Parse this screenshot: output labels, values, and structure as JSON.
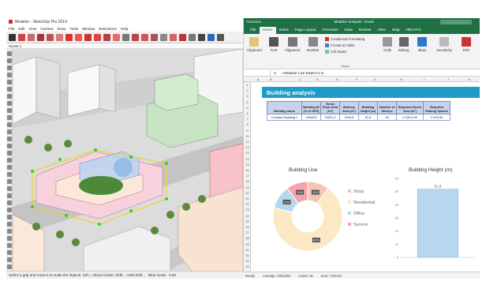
{
  "sketchup": {
    "title": "Modelur - SketchUp Pro 2019",
    "menu": [
      "File",
      "Edit",
      "View",
      "Camera",
      "Draw",
      "Tools",
      "Window",
      "Extensions",
      "Help"
    ],
    "scene_tab": "Scene 1",
    "status_text": "Select a grip and move it to scale the objects. Ctrl = About Center, Shift... Hold Shift...",
    "measurements_label": "Blue Scale",
    "measurements_value": "0.50"
  },
  "excel": {
    "autosave_label": "AutoSave",
    "title": "Modelur Analysis - Excel",
    "ribbon_tabs": [
      "File",
      "Home",
      "Insert",
      "Page Layout",
      "Formulas",
      "Data",
      "Review",
      "View",
      "Help",
      "Nitro Pro"
    ],
    "active_tab": "Home",
    "ribbon": {
      "clipboard": "Clipboard",
      "font": "Font",
      "alignment": "Alignment",
      "number": "Number",
      "conditional_formatting": "Conditional Formatting",
      "format_as_table": "Format as Table",
      "cell_styles": "Cell Styles",
      "styles": "Styles",
      "cells": "Cells",
      "editing": "Editing",
      "ideas": "Ideas",
      "sensitivity": "Sensitivity",
      "pdf": "PDF"
    },
    "formula": "='Modelur Live Data'!C1:I1",
    "columns": [
      "A",
      "B",
      "C",
      "D",
      "E",
      "F",
      "G",
      "H",
      "I",
      "J",
      "K"
    ],
    "rows": [
      "1",
      "2",
      "3",
      "4",
      "5",
      "6",
      "7",
      "8",
      "9",
      "10",
      "11",
      "12",
      "13",
      "14",
      "15",
      "16",
      "17",
      "18",
      "19",
      "20",
      "21",
      "22",
      "23",
      "24",
      "25",
      "26",
      "27",
      "28",
      "29",
      "30",
      "31",
      "32",
      "33"
    ],
    "banner": "Building analysis",
    "table": {
      "headers": [
        "Building name",
        "Building ID (% of GFA)",
        "Gross Floor Area (m²)",
        "Built-up Area (m²)",
        "Building Height (m)",
        "Number of Storeys",
        "Required Green Area (m²)",
        "Required Parking Spaces"
      ],
      "row": [
        "Complex Building 1",
        "100/020",
        "75021,2",
        "2034,6",
        "51,8",
        "15",
        "2.033,2,99",
        "2.200,00"
      ]
    },
    "sheet_tabs": [
      "Modelur Live Data",
      "Building analysis"
    ],
    "active_sheet": "Building analysis",
    "status": {
      "ready": "Ready",
      "average": "Average: 10813/03",
      "count": "Count: 15",
      "sum": "Sum: 7448.20"
    }
  },
  "chart_data": [
    {
      "type": "pie",
      "title": "Building Use",
      "categories": [
        "Shop",
        "Residential",
        "Office",
        "Service"
      ],
      "values": [
        10,
        69,
        11,
        10
      ],
      "data_labels": [
        "10%",
        "69%",
        "11%",
        "10%"
      ],
      "colors": [
        "#f2c4b4",
        "#fce8c4",
        "#b7d7ef",
        "#f5a3ae"
      ],
      "legend": "right"
    },
    {
      "type": "bar",
      "title": "Building Height (m)",
      "categories": [
        ""
      ],
      "values": [
        51.8
      ],
      "data_labels": [
        "51,8"
      ],
      "ylim": [
        0,
        60
      ],
      "yticks": [
        "0",
        "10",
        "20",
        "30",
        "40",
        "50",
        "60"
      ],
      "color": "#b7d7ef",
      "grid": false
    }
  ]
}
